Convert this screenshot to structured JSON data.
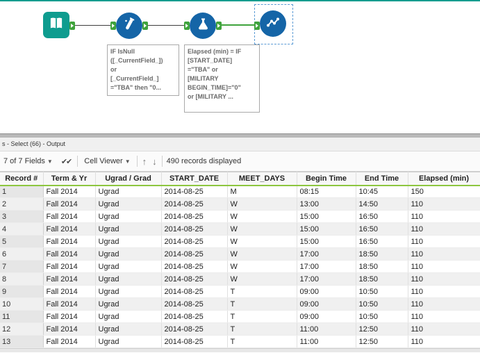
{
  "colors": {
    "accent_teal": "#0e9c8f",
    "tool_blue": "#1565a7",
    "anchor_green": "#3fa33c",
    "selection_blue": "#5b9bd5",
    "header_underline_green": "#8dc63f"
  },
  "canvas": {
    "tools": [
      {
        "icon": "input-data-book-icon"
      },
      {
        "icon": "formula-test-tube-icon"
      },
      {
        "icon": "formula-flask-icon"
      },
      {
        "icon": "chart-scatter-icon"
      }
    ],
    "annotations": [
      {
        "text": "IF IsNull\n([_CurrentField_])\nor\n[_CurrentField_]\n=\"TBA\" then \"0..."
      },
      {
        "text": "Elapsed (min) = IF\n[START_DATE]\n=\"TBA\" or\n[MILITARY\nBEGIN_TIME]=\"0\"\nor [MILITARY ..."
      }
    ]
  },
  "results": {
    "title": "s - Select (66) - Output",
    "toolbar": {
      "fields_label": "7 of 7 Fields",
      "dropdown_caret": "▼",
      "apply_checks": "✔✔",
      "cell_viewer_label": "Cell Viewer",
      "up_arrow": "↑",
      "down_arrow": "↓",
      "records_label": "490 records displayed"
    },
    "table": {
      "columns": [
        "Record #",
        "Term & Yr",
        "Ugrad / Grad",
        "START_DATE",
        "MEET_DAYS",
        "Begin Time",
        "End Time",
        "Elapsed (min)"
      ],
      "rows": [
        [
          "1",
          "Fall 2014",
          "Ugrad",
          "2014-08-25",
          "M",
          "08:15",
          "10:45",
          "150"
        ],
        [
          "2",
          "Fall 2014",
          "Ugrad",
          "2014-08-25",
          "W",
          "13:00",
          "14:50",
          "110"
        ],
        [
          "3",
          "Fall 2014",
          "Ugrad",
          "2014-08-25",
          "W",
          "15:00",
          "16:50",
          "110"
        ],
        [
          "4",
          "Fall 2014",
          "Ugrad",
          "2014-08-25",
          "W",
          "15:00",
          "16:50",
          "110"
        ],
        [
          "5",
          "Fall 2014",
          "Ugrad",
          "2014-08-25",
          "W",
          "15:00",
          "16:50",
          "110"
        ],
        [
          "6",
          "Fall 2014",
          "Ugrad",
          "2014-08-25",
          "W",
          "17:00",
          "18:50",
          "110"
        ],
        [
          "7",
          "Fall 2014",
          "Ugrad",
          "2014-08-25",
          "W",
          "17:00",
          "18:50",
          "110"
        ],
        [
          "8",
          "Fall 2014",
          "Ugrad",
          "2014-08-25",
          "W",
          "17:00",
          "18:50",
          "110"
        ],
        [
          "9",
          "Fall 2014",
          "Ugrad",
          "2014-08-25",
          "T",
          "09:00",
          "10:50",
          "110"
        ],
        [
          "10",
          "Fall 2014",
          "Ugrad",
          "2014-08-25",
          "T",
          "09:00",
          "10:50",
          "110"
        ],
        [
          "11",
          "Fall 2014",
          "Ugrad",
          "2014-08-25",
          "T",
          "09:00",
          "10:50",
          "110"
        ],
        [
          "12",
          "Fall 2014",
          "Ugrad",
          "2014-08-25",
          "T",
          "11:00",
          "12:50",
          "110"
        ],
        [
          "13",
          "Fall 2014",
          "Ugrad",
          "2014-08-25",
          "T",
          "11:00",
          "12:50",
          "110"
        ]
      ]
    }
  }
}
